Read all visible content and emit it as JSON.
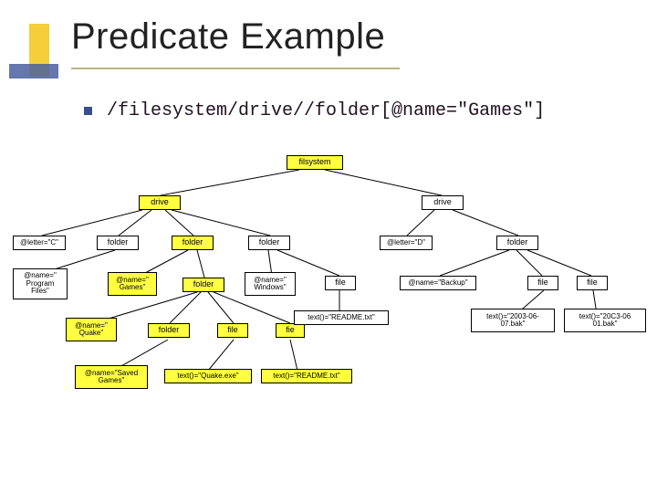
{
  "slide": {
    "title": "Predicate Example",
    "bullet_xpath": "/filesystem/drive//folder[@name=\"Games\"]"
  },
  "tree": {
    "root": "filsystem",
    "drive1": "drive",
    "drive2": "drive",
    "attr_letter_c": "@letter=\"C\"",
    "folder_c1": "folder",
    "folder_c2": "folder",
    "folder_c3": "folder",
    "attr_letter_d": "@letter=\"D\"",
    "folder_d": "folder",
    "attr_program_files": "@name=\"\nProgram\nFiles\"",
    "attr_games": "@name=\"\nGames\"",
    "folder_games_sub": "folder",
    "attr_windows": "@name=\"\nWindows\"",
    "file_readme_c": "file",
    "attr_backup": "@name=\"Backup\"",
    "file_d1": "file",
    "file_d2": "file",
    "attr_quake": "@name=\"\nQuake\"",
    "folder_saved": "folder",
    "file_quakeexe": "file",
    "file_readme2": "fie",
    "txt_readme1": "text()=\"README.txt\"",
    "txt_backup_date": "text()=\"2003-06-\n07.bak\"",
    "txt_d2_date": "text()=\"20C3-06\n01.bak\"",
    "attr_saved_games": "@name=\"Saved\nGames\"",
    "txt_quakeexe": "text()=\"Quake.exe\"",
    "txt_readme2": "text()=\"README.txt\""
  },
  "highlighted_path": [
    "root",
    "drive1",
    "folder_c2",
    "attr_games",
    "folder_games_sub",
    "attr_quake",
    "folder_saved",
    "file_quakeexe",
    "file_readme2",
    "attr_saved_games",
    "txt_quakeexe",
    "txt_readme2"
  ]
}
